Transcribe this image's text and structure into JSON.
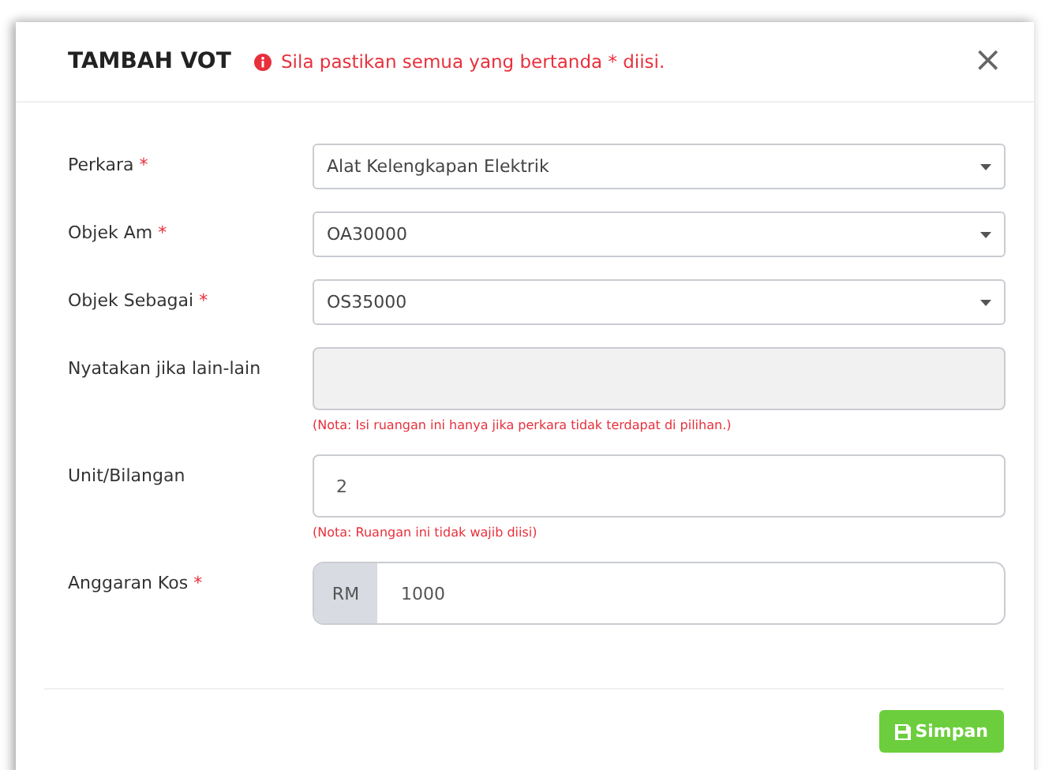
{
  "dialog": {
    "title": "TAMBAH VOT",
    "alert": "Sila pastikan semua yang bertanda * diisi.",
    "close": "×"
  },
  "fields": [
    {
      "kind": "select",
      "label": "Perkara",
      "mark": "*",
      "value": "Alat Kelengkapan Elektrik"
    },
    {
      "kind": "select",
      "label": "Objek Am",
      "mark": "*",
      "value": "OA30000"
    },
    {
      "kind": "select",
      "label": "Objek Sebagai",
      "mark": "*",
      "value": "OS35000"
    },
    {
      "kind": "text",
      "label": "Nyatakan jika lain-lain",
      "disabled": true,
      "note": "(Nota: Isi ruangan ini hanya jika perkara tidak terdapat di pilihan.)"
    },
    {
      "kind": "text",
      "label": "Unit/Bilangan",
      "disabled": false,
      "value": "2",
      "note": "(Nota: Ruangan ini tidak wajib diisi)"
    },
    {
      "kind": "currency",
      "label": "Anggaran Kos",
      "mark": "*",
      "prefix": "RM",
      "value": "1000"
    }
  ],
  "buttons": [
    {
      "label": "Simpan"
    }
  ]
}
